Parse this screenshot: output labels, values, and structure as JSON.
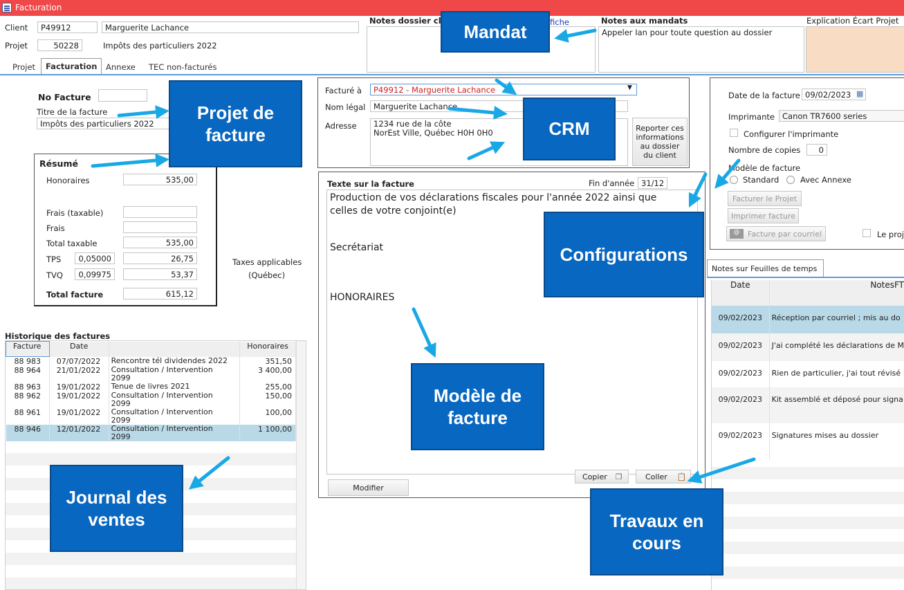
{
  "window": {
    "title": "Facturation"
  },
  "header": {
    "client_label": "Client",
    "client_code": "P49912",
    "client_name": "Marguerite Lachance",
    "projet_label": "Projet",
    "projet_num": "50228",
    "projet_desc": "Impôts des particuliers  2022",
    "notes_dossier_label": "Notes dossier cl",
    "fiche_link": "fiche",
    "notes_mandats_label": "Notes aux mandats",
    "notes_mandats_text": "Appeler Ian pour toute question au dossier",
    "explication_label": "Explication Écart Projet"
  },
  "tabs": [
    "Projet",
    "Facturation",
    "Annexe",
    "TEC non-facturés"
  ],
  "facture": {
    "no_label": "No Facture",
    "no_value": "",
    "titre_label": "Titre de la facture",
    "titre_value": "Impôts des particuliers  2022"
  },
  "resume": {
    "title": "Résumé",
    "honoraires_label": "Honoraires",
    "honoraires": "535,00",
    "frais_taxable_label": "Frais (taxable)",
    "frais_taxable": "",
    "frais_label": "Frais",
    "frais": "",
    "total_taxable_label": "Total taxable",
    "total_taxable": "535,00",
    "tps_label": "TPS",
    "tps_rate": "0,05000",
    "tps": "26,75",
    "tvq_label": "TVQ",
    "tvq_rate": "0,09975",
    "tvq": "53,37",
    "total_label": "Total facture",
    "total": "615,12",
    "taxes_line1": "Taxes applicables",
    "taxes_line2": "(Québec)"
  },
  "historique": {
    "title": "Historique des factures",
    "columns": [
      "Facture",
      "Date",
      "",
      "Honoraires"
    ],
    "rows": [
      {
        "facture": "88 983",
        "date": "07/07/2022",
        "desc": "Rencontre tél dividendes 2022",
        "desc2": "",
        "hon": "351,50"
      },
      {
        "facture": "88 964",
        "date": "21/01/2022",
        "desc": "Consultation / Intervention",
        "desc2": "2099",
        "hon": "3 400,00"
      },
      {
        "facture": "88 963",
        "date": "19/01/2022",
        "desc": "Tenue de livres 2021",
        "desc2": "",
        "hon": "255,00"
      },
      {
        "facture": "88 962",
        "date": "19/01/2022",
        "desc": "Consultation / Intervention",
        "desc2": "2099",
        "hon": "150,00"
      },
      {
        "facture": "88 961",
        "date": "19/01/2022",
        "desc": "Consultation / Intervention",
        "desc2": "2099",
        "hon": "100,00"
      },
      {
        "facture": "88 946",
        "date": "12/01/2022",
        "desc": "Consultation / Intervention",
        "desc2": "2099",
        "hon": "1 100,00"
      }
    ]
  },
  "crm": {
    "facture_a_label": "Facturé à",
    "facture_a": "P49912 - Marguerite Lachance",
    "nom_legal_label": "Nom légal",
    "nom_legal": "Marguerite Lachance",
    "adresse_label": "Adresse",
    "adresse_l1": "1234 rue de la côte",
    "adresse_l2": "NorEst Ville, Québec  H0H 0H0",
    "reporter_btn": "Reporter ces informations au dossier du client"
  },
  "texte": {
    "label": "Texte sur la facture",
    "fin_annee_label": "Fin d'année",
    "fin_annee": "31/12",
    "line1": "Production de vos déclarations fiscales pour l'année 2022 ainsi que",
    "line2": "celles de votre conjoint(e)",
    "line3": "Secrétariat",
    "line4": "HONORAIRES",
    "copier": "Copier",
    "coller": "Coller",
    "modifier": "Modifier"
  },
  "config": {
    "date_label": "Date de la facture",
    "date": "09/02/2023",
    "imprimante_label": "Imprimante",
    "imprimante": "Canon TR7600 series",
    "configurer_label": "Configurer l'imprimante",
    "copies_label": "Nombre de copies",
    "copies": "0",
    "modele_label": "Modèle de facture",
    "standard": "Standard",
    "avec_annexe": "Avec Annexe",
    "facturer_btn": "Facturer le Projet",
    "imprimer_btn": "Imprimer facture",
    "courriel_btn": "Facture par courriel",
    "le_proj": "Le proj"
  },
  "notesft": {
    "tab": "Notes sur Feuilles de temps",
    "columns": [
      "Date",
      "NotesFT"
    ],
    "rows": [
      {
        "date": "09/02/2023",
        "note": "Réception par courriel ; mis au do"
      },
      {
        "date": "09/02/2023",
        "note": "J'ai complété les déclarations de M"
      },
      {
        "date": "09/02/2023",
        "note": "Rien de particulier, j'ai tout révisé"
      },
      {
        "date": "09/02/2023",
        "note": "Kit assemblé et déposé pour signa"
      },
      {
        "date": "09/02/2023",
        "note": "Signatures mises au dossier"
      }
    ]
  },
  "callouts": {
    "mandat": "Mandat",
    "projet_facture_1": "Projet de",
    "projet_facture_2": "facture",
    "crm": "CRM",
    "configurations": "Configurations",
    "modele_1": "Modèle de",
    "modele_2": "facture",
    "journal_1": "Journal des",
    "journal_2": "ventes",
    "travaux_1": "Travaux en",
    "travaux_2": "cours"
  },
  "colors": {
    "titlebar": "#f04848",
    "callout": "#0867c0",
    "arrow": "#19a8e6",
    "selected_row": "#b9d9e8",
    "peach": "#f9dcc4"
  }
}
